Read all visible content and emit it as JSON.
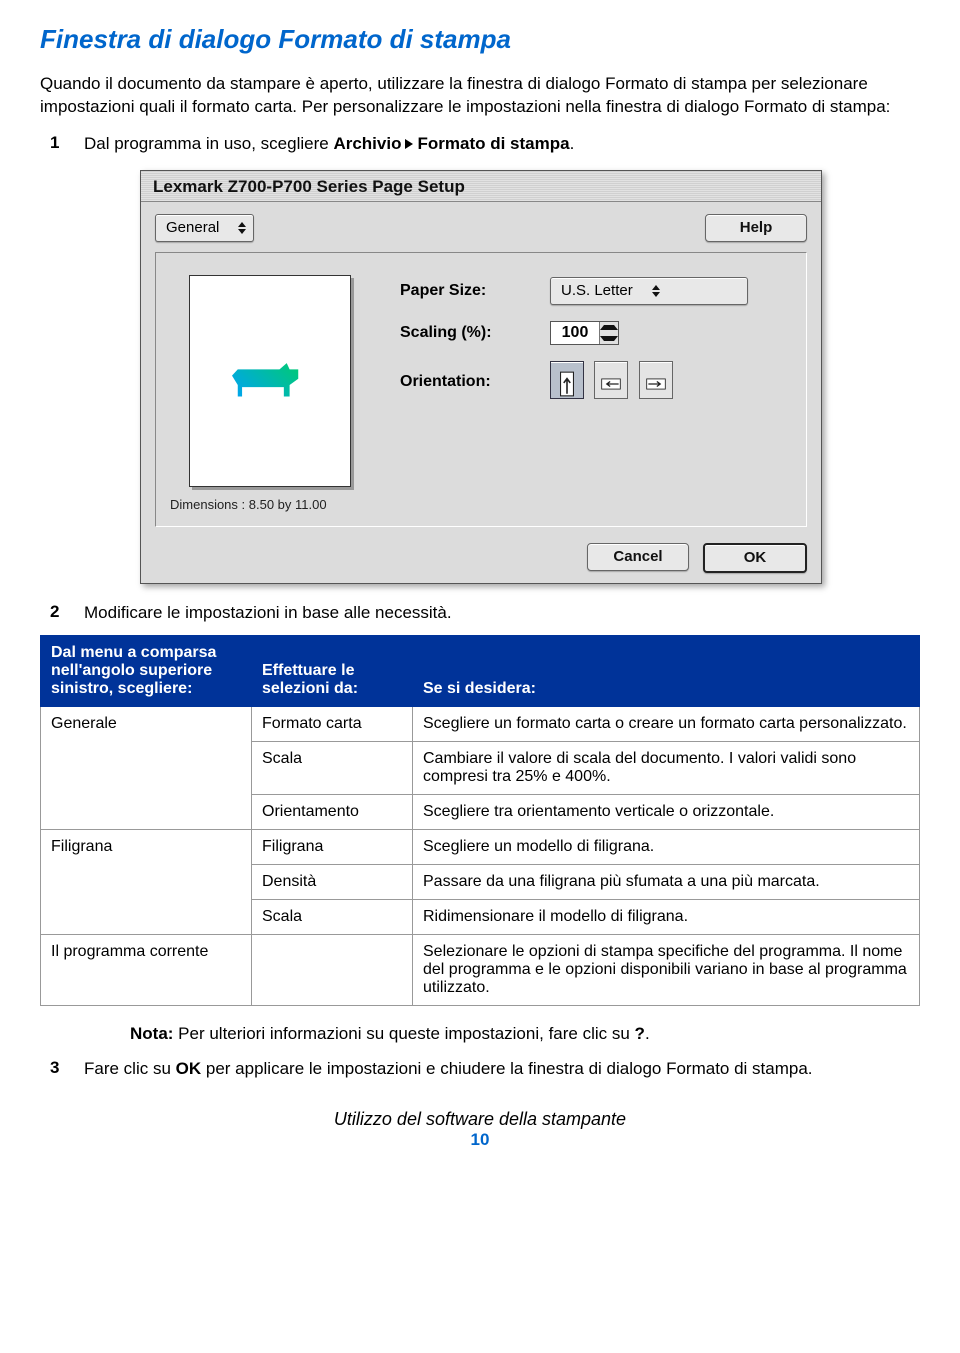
{
  "title": "Finestra di dialogo Formato di stampa",
  "intro": "Quando il documento da stampare è aperto, utilizzare la finestra di dialogo Formato di stampa per selezionare impostazioni quali il formato carta. Per personalizzare le impostazioni nella finestra di dialogo Formato di stampa:",
  "step1": {
    "num": "1",
    "prefix": "Dal programma in uso, scegliere ",
    "menu1": "Archivio",
    "menu2": "Formato di stampa",
    "suffix": "."
  },
  "dialog": {
    "title": "Lexmark Z700-P700 Series Page Setup",
    "general": "General",
    "help": "Help",
    "papersize_label": "Paper Size:",
    "papersize_value": "U.S. Letter",
    "scaling_label": "Scaling (%):",
    "scaling_value": "100",
    "orientation_label": "Orientation:",
    "dimensions": "Dimensions : 8.50 by 11.00",
    "cancel": "Cancel",
    "ok": "OK"
  },
  "step2": {
    "num": "2",
    "text": "Modificare le impostazioni in base alle necessità."
  },
  "table": {
    "h1": "Dal menu a comparsa nell'angolo superiore sinistro, scegliere:",
    "h2": "Effettuare le selezioni da:",
    "h3": "Se si desidera:",
    "rows": [
      {
        "c1": "Generale",
        "c2": "Formato carta",
        "c3": "Scegliere un formato carta o creare un formato carta personalizzato."
      },
      {
        "c1": "",
        "c2": "Scala",
        "c3": "Cambiare il valore di scala del documento. I valori validi sono compresi tra 25% e 400%."
      },
      {
        "c1": "",
        "c2": "Orientamento",
        "c3": "Scegliere tra orientamento verticale o orizzontale."
      },
      {
        "c1": "Filigrana",
        "c2": "Filigrana",
        "c3": "Scegliere un modello di filigrana."
      },
      {
        "c1": "",
        "c2": "Densità",
        "c3": "Passare da una filigrana più sfumata a una più marcata."
      },
      {
        "c1": "",
        "c2": "Scala",
        "c3": "Ridimensionare il modello di filigrana."
      },
      {
        "c1": "Il programma corrente",
        "c2": "",
        "c3": "Selezionare le opzioni di stampa specifiche del programma. Il nome del programma e le opzioni disponibili variano in base al programma utilizzato."
      }
    ]
  },
  "note": {
    "label": "Nota:",
    "text": " Per ulteriori informazioni su queste impostazioni, fare clic su ",
    "q": "?",
    "end": "."
  },
  "step3": {
    "num": "3",
    "prefix": "Fare clic su ",
    "ok": "OK",
    "suffix": " per applicare le impostazioni e chiudere la finestra di dialogo Formato di stampa."
  },
  "footer": {
    "title": "Utilizzo del software della stampante",
    "page": "10"
  }
}
